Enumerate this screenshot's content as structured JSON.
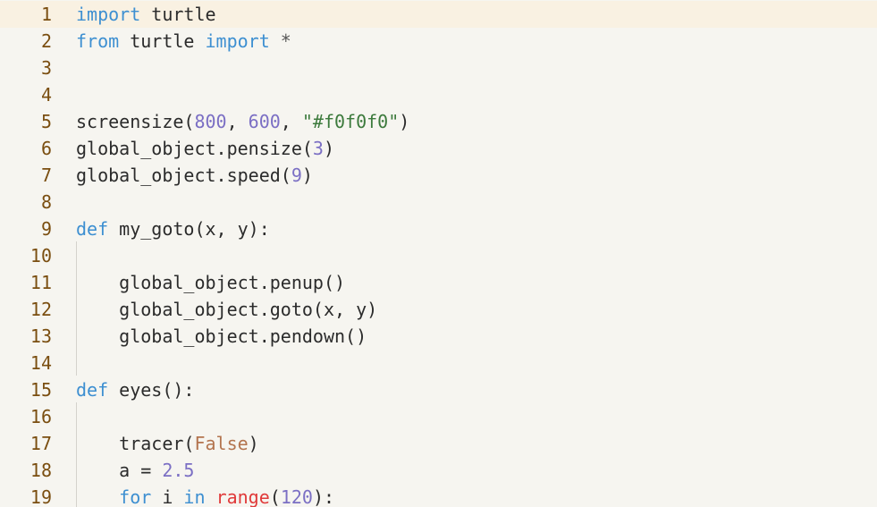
{
  "editor": {
    "current_line": 1,
    "lines": [
      {
        "n": "1",
        "tokens": [
          {
            "t": "import",
            "c": "kw"
          },
          {
            "t": " turtle",
            "c": "id"
          }
        ]
      },
      {
        "n": "2",
        "tokens": [
          {
            "t": "from",
            "c": "kw"
          },
          {
            "t": " turtle ",
            "c": "id"
          },
          {
            "t": "import",
            "c": "kw"
          },
          {
            "t": " *",
            "c": "op"
          }
        ]
      },
      {
        "n": "3",
        "tokens": []
      },
      {
        "n": "4",
        "tokens": []
      },
      {
        "n": "5",
        "tokens": [
          {
            "t": "screensize(",
            "c": "id"
          },
          {
            "t": "800",
            "c": "num"
          },
          {
            "t": ", ",
            "c": "id"
          },
          {
            "t": "600",
            "c": "num"
          },
          {
            "t": ", ",
            "c": "id"
          },
          {
            "t": "\"#f0f0f0\"",
            "c": "str"
          },
          {
            "t": ")",
            "c": "id"
          }
        ]
      },
      {
        "n": "6",
        "tokens": [
          {
            "t": "global_object.pensize(",
            "c": "id"
          },
          {
            "t": "3",
            "c": "num"
          },
          {
            "t": ")",
            "c": "id"
          }
        ]
      },
      {
        "n": "7",
        "tokens": [
          {
            "t": "global_object.speed(",
            "c": "id"
          },
          {
            "t": "9",
            "c": "num"
          },
          {
            "t": ")",
            "c": "id"
          }
        ]
      },
      {
        "n": "8",
        "tokens": []
      },
      {
        "n": "9",
        "tokens": [
          {
            "t": "def",
            "c": "kw"
          },
          {
            "t": " my_goto(x, y):",
            "c": "id"
          }
        ]
      },
      {
        "n": "10",
        "tokens": []
      },
      {
        "n": "11",
        "tokens": [
          {
            "t": "    global_object.penup()",
            "c": "id"
          }
        ]
      },
      {
        "n": "12",
        "tokens": [
          {
            "t": "    global_object.goto(x, y)",
            "c": "id"
          }
        ]
      },
      {
        "n": "13",
        "tokens": [
          {
            "t": "    global_object.pendown()",
            "c": "id"
          }
        ]
      },
      {
        "n": "14",
        "tokens": []
      },
      {
        "n": "15",
        "tokens": [
          {
            "t": "def",
            "c": "kw"
          },
          {
            "t": " eyes():",
            "c": "id"
          }
        ]
      },
      {
        "n": "16",
        "tokens": []
      },
      {
        "n": "17",
        "tokens": [
          {
            "t": "    tracer(",
            "c": "id"
          },
          {
            "t": "False",
            "c": "const"
          },
          {
            "t": ")",
            "c": "id"
          }
        ]
      },
      {
        "n": "18",
        "tokens": [
          {
            "t": "    a = ",
            "c": "id"
          },
          {
            "t": "2.5",
            "c": "num"
          }
        ]
      },
      {
        "n": "19",
        "tokens": [
          {
            "t": "    ",
            "c": "id"
          },
          {
            "t": "for",
            "c": "kw"
          },
          {
            "t": " i ",
            "c": "id"
          },
          {
            "t": "in",
            "c": "kw"
          },
          {
            "t": " ",
            "c": "id"
          },
          {
            "t": "range",
            "c": "builtin"
          },
          {
            "t": "(",
            "c": "id"
          },
          {
            "t": "120",
            "c": "num"
          },
          {
            "t": "):",
            "c": "id"
          }
        ]
      }
    ]
  }
}
